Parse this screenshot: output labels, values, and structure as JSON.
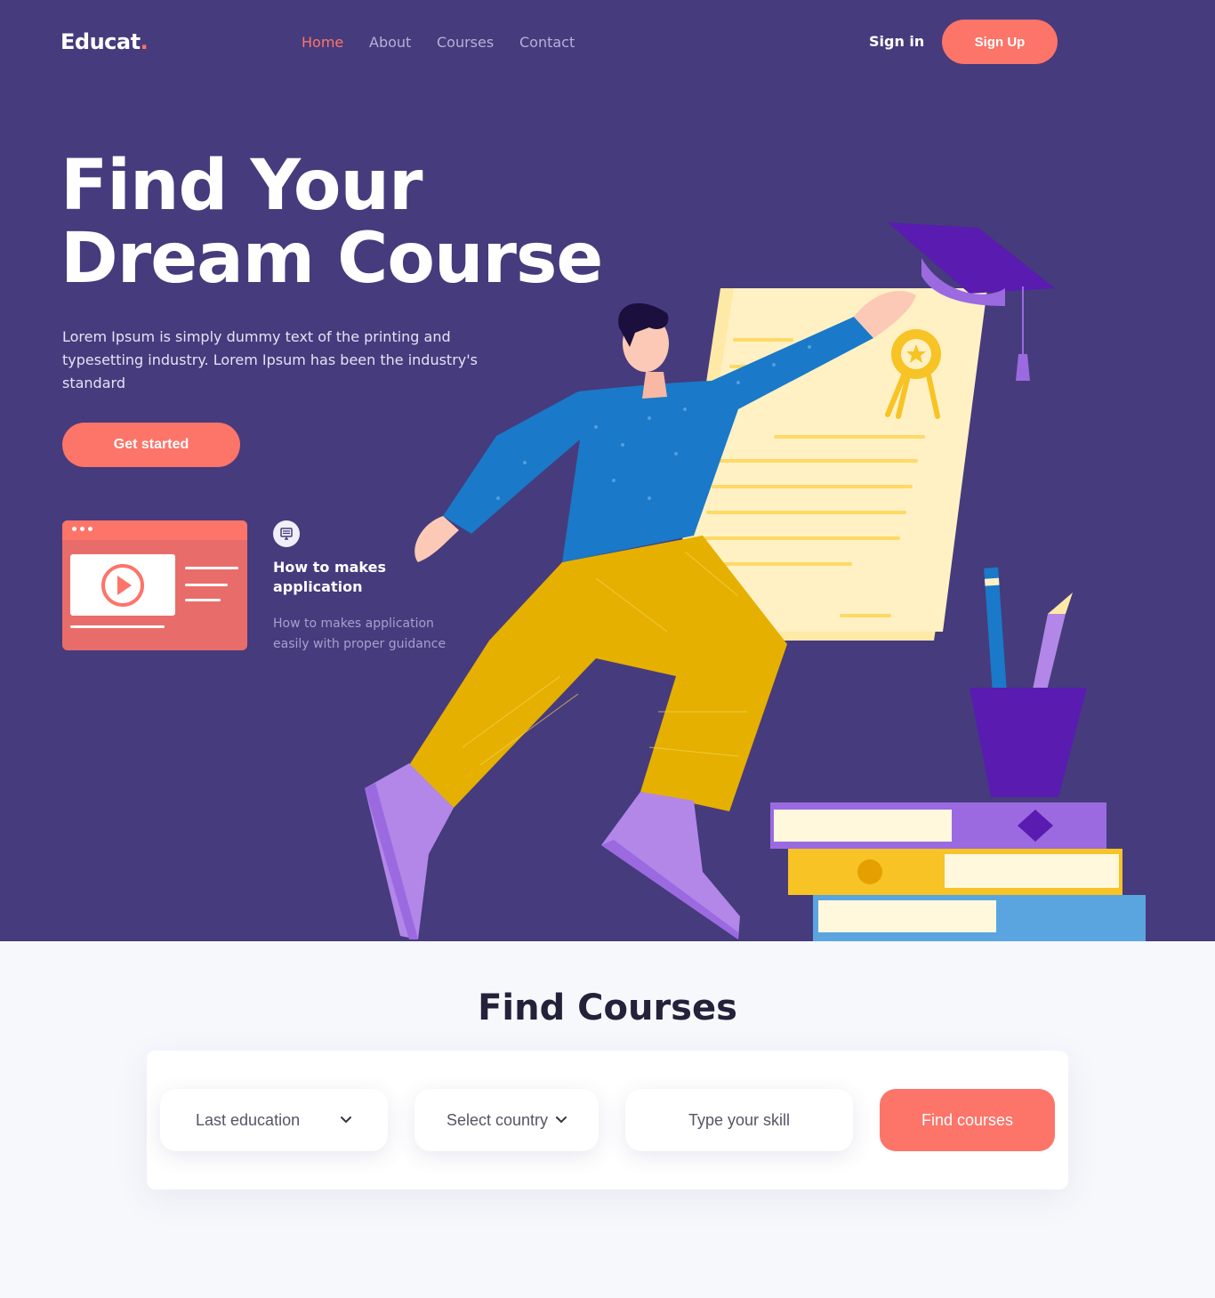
{
  "brand": {
    "name": "Educat",
    "dot": "."
  },
  "nav": {
    "links": [
      {
        "label": "Home",
        "active": true
      },
      {
        "label": "About",
        "active": false
      },
      {
        "label": "Courses",
        "active": false
      },
      {
        "label": "Contact",
        "active": false
      }
    ],
    "signin_label": "Sign in",
    "signup_label": "Sign Up"
  },
  "hero": {
    "title_line1": "Find Your",
    "title_line2": "Dream Course",
    "description": "Lorem Ipsum is simply dummy text of the printing and typesetting industry. Lorem Ipsum has been the industry's standard",
    "cta_label": "Get started"
  },
  "feature": {
    "title": "How to makes application",
    "description": "How to makes application easily with proper guidance",
    "icon": "monitor-icon",
    "video_icon": "play-icon"
  },
  "search": {
    "title": "Find Courses",
    "education_label": "Last education",
    "country_label": "Select country",
    "skill_placeholder": "Type your skill",
    "button_label": "Find courses"
  },
  "colors": {
    "hero_bg": "#463b7c",
    "accent": "#fd7469",
    "page_bg": "#f7f8fc"
  }
}
